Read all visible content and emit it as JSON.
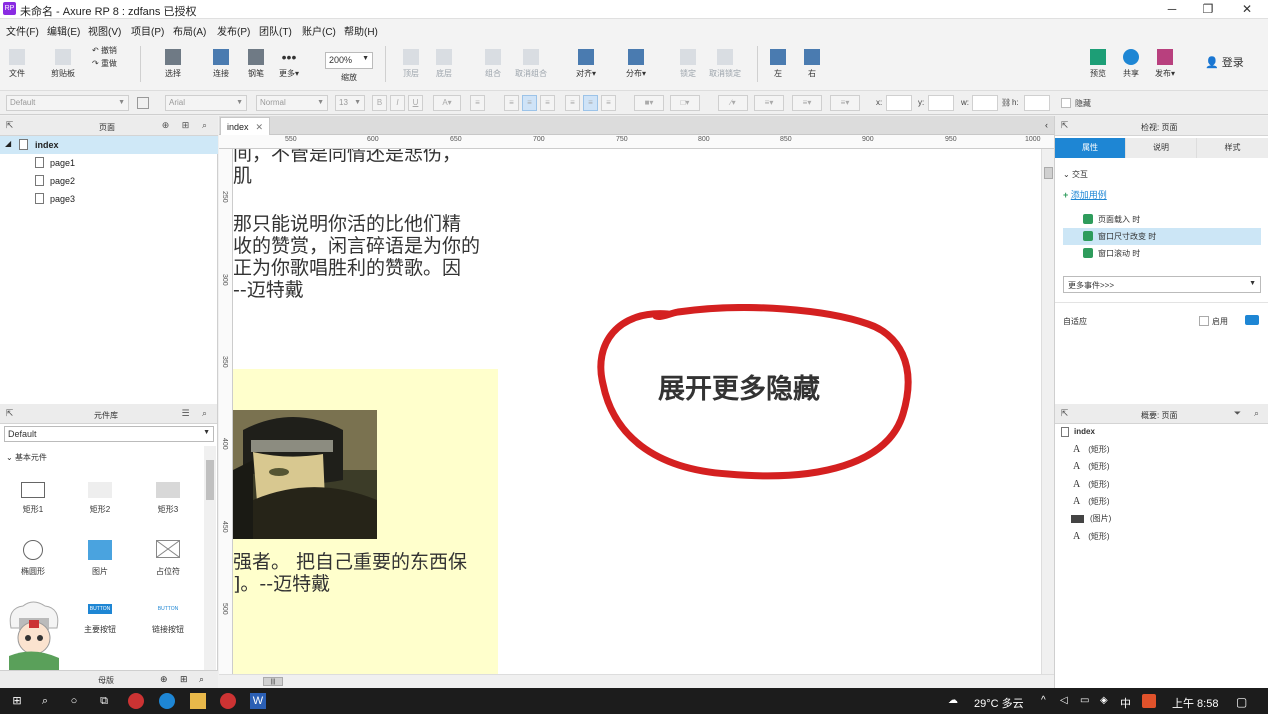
{
  "window": {
    "title": "未命名 - Axure RP 8 : zdfans 已授权",
    "app_icon": "RP",
    "minimize": "─",
    "maximize": "❐",
    "close": "✕"
  },
  "menu": [
    "文件(F)",
    "编辑(E)",
    "视图(V)",
    "项目(P)",
    "布局(A)",
    "发布(P)",
    "团队(T)",
    "账户(C)",
    "帮助(H)"
  ],
  "toolbar": {
    "file": "文件",
    "clipboard": "剪贴板",
    "undo": "撤销",
    "redo": "重做",
    "select": "选择",
    "connect": "连接",
    "pen": "钢笔",
    "more": "更多▾",
    "zoom_value": "200%",
    "zoom_label": "缩放",
    "top": "顶层",
    "bottom": "底层",
    "group": "组合",
    "ungroup": "取消组合",
    "align": "对齐▾",
    "distribute": "分布▾",
    "lock": "锁定",
    "unlock": "取消锁定",
    "left": "左",
    "right": "右",
    "preview": "预览",
    "share": "共享",
    "publish": "发布▾",
    "login": "登录"
  },
  "format": {
    "style": "Default",
    "font": "Arial",
    "weight": "Normal",
    "size": "13",
    "x_label": "x:",
    "y_label": "y:",
    "w_label": "w:",
    "h_label": "h:",
    "hidden_label": "隐藏"
  },
  "pages_panel": {
    "title": "页面",
    "items": [
      {
        "label": "index"
      },
      {
        "label": "page1"
      },
      {
        "label": "page2"
      },
      {
        "label": "page3"
      }
    ]
  },
  "library": {
    "title": "元件库",
    "selected": "Default",
    "section": "基本元件",
    "widgets": [
      "矩形1",
      "矩形2",
      "矩形3",
      "椭圆形",
      "图片",
      "占位符",
      "主要按钮",
      "链接按钮"
    ],
    "button_text": "BUTTON"
  },
  "masters": {
    "title": "母版"
  },
  "canvas": {
    "tab": "index",
    "ruler_h": [
      "550",
      "600",
      "650",
      "700",
      "750",
      "800",
      "850",
      "900",
      "950",
      "1000"
    ],
    "ruler_v": [
      "250",
      "300",
      "350",
      "400",
      "450",
      "500"
    ],
    "quote1_a": "间，不管是同情还是悲伤，",
    "quote1_b": "肌",
    "quote2": "那只能说明你活的比他们精\n收的赞赏，闲言碎语是为你的\n正为你歌唱胜利的赞歌。因\n--迈特戴",
    "quote3": "强者。 把自己重要的东西保\n]。--迈特戴",
    "toggle": "展开更多隐藏"
  },
  "inspector": {
    "title": "检视: 页面",
    "tabs": [
      "属性",
      "说明",
      "样式"
    ],
    "section": "交互",
    "add_case": "添加用例",
    "events": [
      "页面载入 时",
      "窗口尺寸改变 时",
      "窗口滚动 时"
    ],
    "more_events": "更多事件>>>",
    "adaptive": "自适应",
    "enable": "启用"
  },
  "outline": {
    "title": "概要: 页面",
    "root": "index",
    "items": [
      {
        "icon": "A",
        "label": "(矩形)"
      },
      {
        "icon": "A",
        "label": "(矩形)"
      },
      {
        "icon": "A",
        "label": "(矩形)"
      },
      {
        "icon": "A",
        "label": "(矩形)"
      },
      {
        "icon": "img",
        "label": "(图片)"
      },
      {
        "icon": "A",
        "label": "(矩形)"
      }
    ]
  },
  "taskbar": {
    "weather": "29°C 多云",
    "ime": "中",
    "time": "上午 8:58"
  },
  "colors": {
    "accent": "#1e86d4",
    "annotation": "#d42020",
    "highlight": "#ffffcc"
  }
}
